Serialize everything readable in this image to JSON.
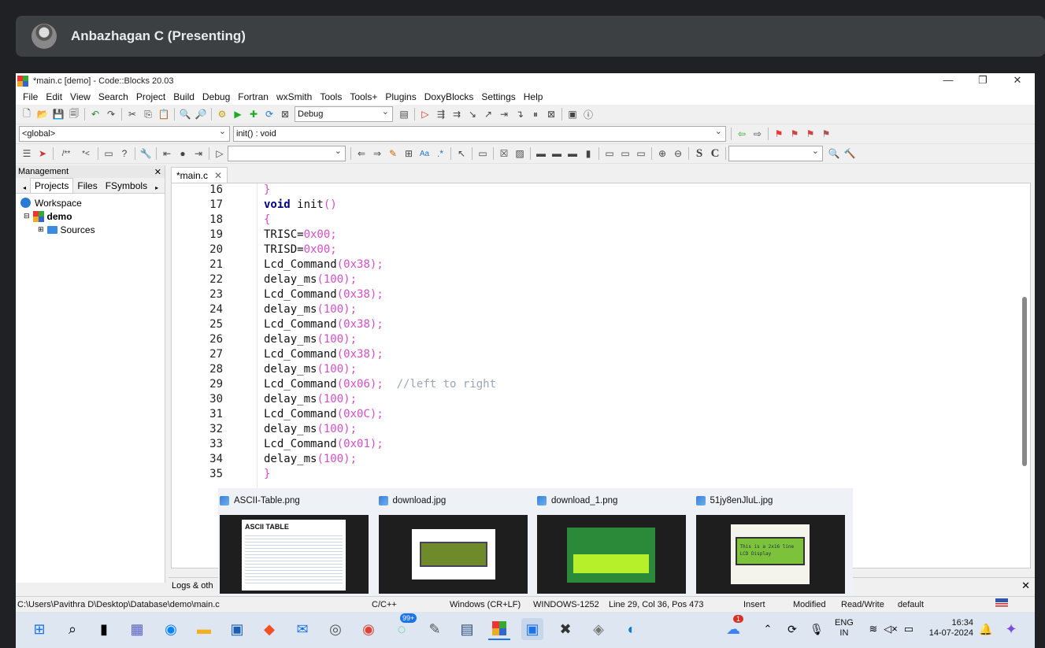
{
  "meet": {
    "presenter": "Anbazhagan C (Presenting)"
  },
  "window": {
    "title": "*main.c [demo] - Code::Blocks 20.03",
    "controls": [
      "—",
      "❐",
      "✕"
    ]
  },
  "menu": [
    "File",
    "Edit",
    "View",
    "Search",
    "Project",
    "Build",
    "Debug",
    "Fortran",
    "wxSmith",
    "Tools",
    "Tools+",
    "Plugins",
    "DoxyBlocks",
    "Settings",
    "Help"
  ],
  "toolbar": {
    "build_target": "Debug",
    "scope": "<global>",
    "function": "init() : void"
  },
  "management": {
    "title": "Management",
    "tabs": [
      "Projects",
      "Files",
      "FSymbols"
    ],
    "tree": {
      "workspace": "Workspace",
      "project": "demo",
      "folder": "Sources"
    }
  },
  "editor": {
    "tab": "*main.c",
    "lines": [
      {
        "n": "16",
        "text": "}"
      },
      {
        "n": "17",
        "text": "void init()"
      },
      {
        "n": "18",
        "text": "{"
      },
      {
        "n": "19",
        "text": "TRISC=0x00;"
      },
      {
        "n": "20",
        "text": "TRISD=0x00;"
      },
      {
        "n": "21",
        "text": "Lcd_Command(0x38);"
      },
      {
        "n": "22",
        "text": "delay_ms(100);"
      },
      {
        "n": "23",
        "text": "Lcd_Command(0x38);"
      },
      {
        "n": "24",
        "text": "delay_ms(100);"
      },
      {
        "n": "25",
        "text": "Lcd_Command(0x38);"
      },
      {
        "n": "26",
        "text": "delay_ms(100);"
      },
      {
        "n": "27",
        "text": "Lcd_Command(0x38);"
      },
      {
        "n": "28",
        "text": "delay_ms(100);"
      },
      {
        "n": "29",
        "text": "Lcd_Command(0x06);  //left to right"
      },
      {
        "n": "30",
        "text": "delay_ms(100);"
      },
      {
        "n": "31",
        "text": "Lcd_Command(0x0C);"
      },
      {
        "n": "32",
        "text": "delay_ms(100);"
      },
      {
        "n": "33",
        "text": "Lcd_Command(0x01);"
      },
      {
        "n": "34",
        "text": "delay_ms(100);"
      },
      {
        "n": "35",
        "text": "}"
      }
    ]
  },
  "thumbnails": [
    {
      "title": "ASCII-Table.png",
      "caption": "ASCII TABLE"
    },
    {
      "title": "download.jpg"
    },
    {
      "title": "download_1.png"
    },
    {
      "title": "51jy8enJluL.jpg",
      "caption": "This is a 2x16 line LCD Display"
    }
  ],
  "logs": {
    "label": "Logs & oth"
  },
  "status": {
    "path": "C:\\Users\\Pavithra D\\Desktop\\Database\\demo\\main.c",
    "lang": "C/C++",
    "eol": "Windows (CR+LF)",
    "encoding": "WINDOWS-1252",
    "position": "Line 29, Col 36, Pos 473",
    "mode": "Insert",
    "modified": "Modified",
    "access": "Read/Write",
    "profile": "default"
  },
  "taskbar": {
    "whatsapp_badge": "99+",
    "weather_badge": "1",
    "lang": "ENG",
    "region": "IN",
    "time": "16:34",
    "date": "14-07-2024"
  }
}
